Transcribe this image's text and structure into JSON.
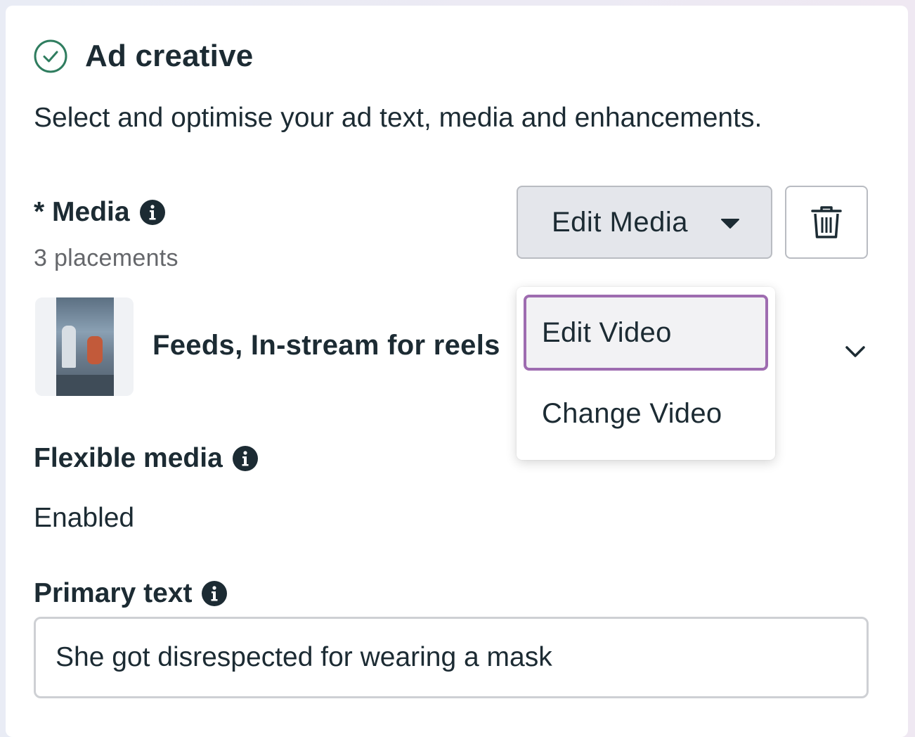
{
  "section": {
    "title": "Ad creative",
    "subtitle": "Select and optimise your ad text, media and enhancements.",
    "status_icon": "check-circle-icon",
    "status_color": "#2f7d5f"
  },
  "media": {
    "label": "* Media",
    "info_icon": "info-icon",
    "placements": "3 placements",
    "edit_button_label": "Edit Media",
    "delete_icon": "trash-icon",
    "item_title": "Feeds, In-stream for reels"
  },
  "dropdown": {
    "items": [
      {
        "label": "Edit Video",
        "selected": true
      },
      {
        "label": "Change Video",
        "selected": false
      }
    ],
    "highlight_color": "#9e6cb0"
  },
  "flexible_media": {
    "label": "Flexible media",
    "value": "Enabled"
  },
  "primary_text": {
    "label": "Primary text",
    "value": "She got disrespected for wearing a mask"
  }
}
